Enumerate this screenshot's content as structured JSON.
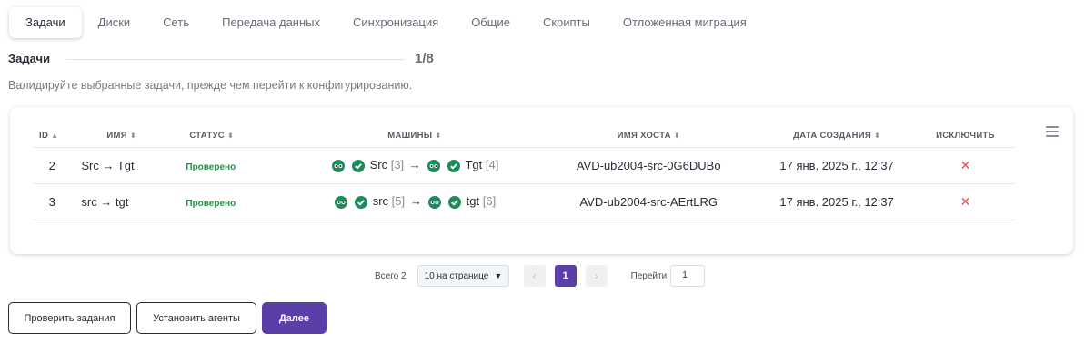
{
  "tabs": [
    "Задачи",
    "Диски",
    "Сеть",
    "Передача данных",
    "Синхронизация",
    "Общие",
    "Скрипты",
    "Отложенная миграция"
  ],
  "step": {
    "title": "Задачи",
    "count": "1/8"
  },
  "description": "Валидируйте выбранные задачи, прежде чем перейти к конфигурированию.",
  "table": {
    "headers": {
      "id": "ID",
      "name": "ИМЯ",
      "status": "СТАТУС",
      "machines": "МАШИНЫ",
      "host": "ИМЯ ХОСТА",
      "date": "ДАТА СОЗДАНИЯ",
      "exclude": "ИСКЛЮЧИТЬ"
    },
    "rows": [
      {
        "id": "2",
        "name": "Src → Tgt",
        "status": "Проверено",
        "src": "Src",
        "src_idx": "[3]",
        "tgt": "Tgt",
        "tgt_idx": "[4]",
        "host": "AVD-ub2004-src-0G6DUBo",
        "date": "17 янв. 2025 г., 12:37",
        "exclude": "✕"
      },
      {
        "id": "3",
        "name": "src → tgt",
        "status": "Проверено",
        "src": "src",
        "src_idx": "[5]",
        "tgt": "tgt",
        "tgt_idx": "[6]",
        "host": "AVD-ub2004-src-AErtLRG",
        "date": "17 янв. 2025 г., 12:37",
        "exclude": "✕"
      }
    ]
  },
  "pagination": {
    "total": "Всего 2",
    "per_page": "10 на странице",
    "current_page": "1",
    "goto_label": "Перейти",
    "goto_value": "1"
  },
  "buttons": {
    "check": "Проверить задания",
    "install": "Установить агенты",
    "next": "Далее"
  },
  "colors": {
    "accent": "#5b3ea8",
    "success": "#2e8b4a",
    "danger": "#d9534f"
  }
}
